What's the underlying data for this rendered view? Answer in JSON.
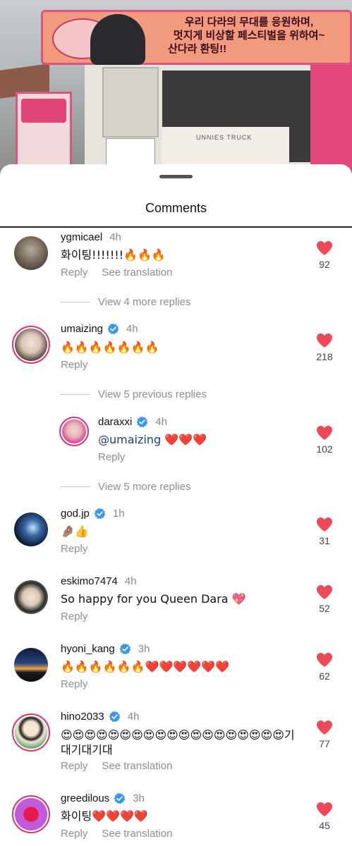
{
  "background": {
    "banner_line1": "우리 다라의 무대를 응원하며,",
    "banner_line2": "멋지게 비상할 페스티벌을 위하여~",
    "banner_line3": "산다라 환팅!!",
    "truck_label": "UNNIES TRUCK"
  },
  "sheet": {
    "title": "Comments"
  },
  "comments": [
    {
      "username": "ygmicael",
      "time": "4h",
      "text": "화이팅!!!!!!!🔥🔥🔥",
      "reply": "Reply",
      "translate": "See translation",
      "likes": "92",
      "verified": false
    },
    {
      "username": "umaizing",
      "time": "4h",
      "text": "🔥🔥🔥🔥🔥🔥🔥",
      "reply": "Reply",
      "likes": "218",
      "verified": true
    },
    {
      "username": "daraxxi",
      "time": "4h",
      "mention": "@umaizing",
      "text": " ❤️❤️❤️",
      "reply": "Reply",
      "likes": "102",
      "verified": true
    },
    {
      "username": "god.jp",
      "time": "1h",
      "text": "🤌🏽👍",
      "reply": "Reply",
      "likes": "31",
      "verified": true
    },
    {
      "username": "eskimo7474",
      "time": "4h",
      "text": "So happy for you Queen Dara 💖",
      "reply": "Reply",
      "likes": "52",
      "verified": false
    },
    {
      "username": "hyoni_kang",
      "time": "3h",
      "text": "🔥🔥🔥🔥🔥🔥❤️❤️❤️❤️❤️❤️",
      "reply": "Reply",
      "likes": "62",
      "verified": true
    },
    {
      "username": "hino2033",
      "time": "4h",
      "text": "😍😍😍😍😍😍😍😍😍😍😍😍😍😍😍😍😍😍😍기대기대기대",
      "reply": "Reply",
      "translate": "See translation",
      "likes": "77",
      "verified": true
    },
    {
      "username": "greedilous",
      "time": "3h",
      "text": "화이팅❤️❤️❤️❤️",
      "reply": "Reply",
      "translate": "See translation",
      "likes": "45",
      "verified": true
    }
  ],
  "view_replies": {
    "more_4": "View 4 more replies",
    "previous_5": "View 5 previous replies",
    "more_5": "View 5 more replies"
  },
  "colors": {
    "like_heart": "#ed4956",
    "verified_badge": "#3897f0",
    "story_ring": "#e1306c"
  },
  "icons": [
    "heart-icon",
    "verified-badge-icon",
    "drag-handle"
  ]
}
